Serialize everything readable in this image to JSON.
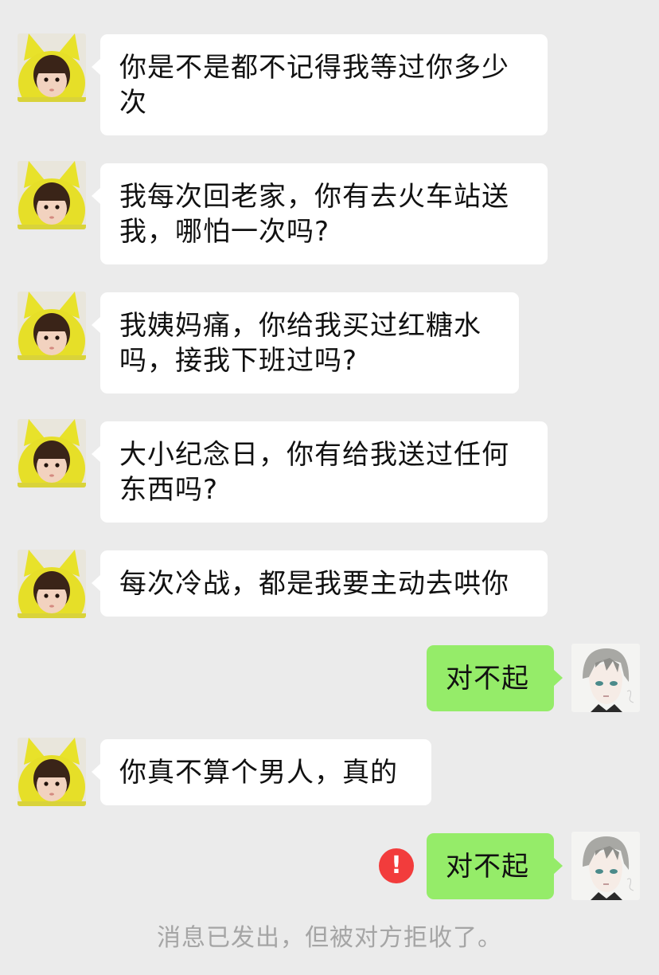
{
  "chat": {
    "messages": [
      {
        "sender": "other",
        "text": "你是不是都不记得我等过你多少次"
      },
      {
        "sender": "other",
        "text": "我每次回老家，你有去火车站送我，哪怕一次吗?"
      },
      {
        "sender": "other",
        "text": "我姨妈痛，你给我买过红糖水吗，接我下班过吗?"
      },
      {
        "sender": "other",
        "text": "大小纪念日，你有给我送过任何东西吗?"
      },
      {
        "sender": "other",
        "text": "每次冷战，都是我要主动去哄你"
      },
      {
        "sender": "self",
        "text": "对不起"
      },
      {
        "sender": "other",
        "text": "你真不算个男人，真的"
      },
      {
        "sender": "self",
        "text": "对不起",
        "failed": true
      }
    ],
    "error_glyph": "!",
    "system_notice": "消息已发出，但被对方拒收了。"
  },
  "colors": {
    "background": "#ebebeb",
    "incoming_bubble": "#ffffff",
    "outgoing_bubble": "#95ec69",
    "error": "#f23c3c",
    "notice_text": "#a5a5a5"
  },
  "icons": {
    "other_avatar": "girl-yellow-hood-avatar",
    "self_avatar": "anime-boy-avatar",
    "failed_status": "exclamation-icon"
  }
}
